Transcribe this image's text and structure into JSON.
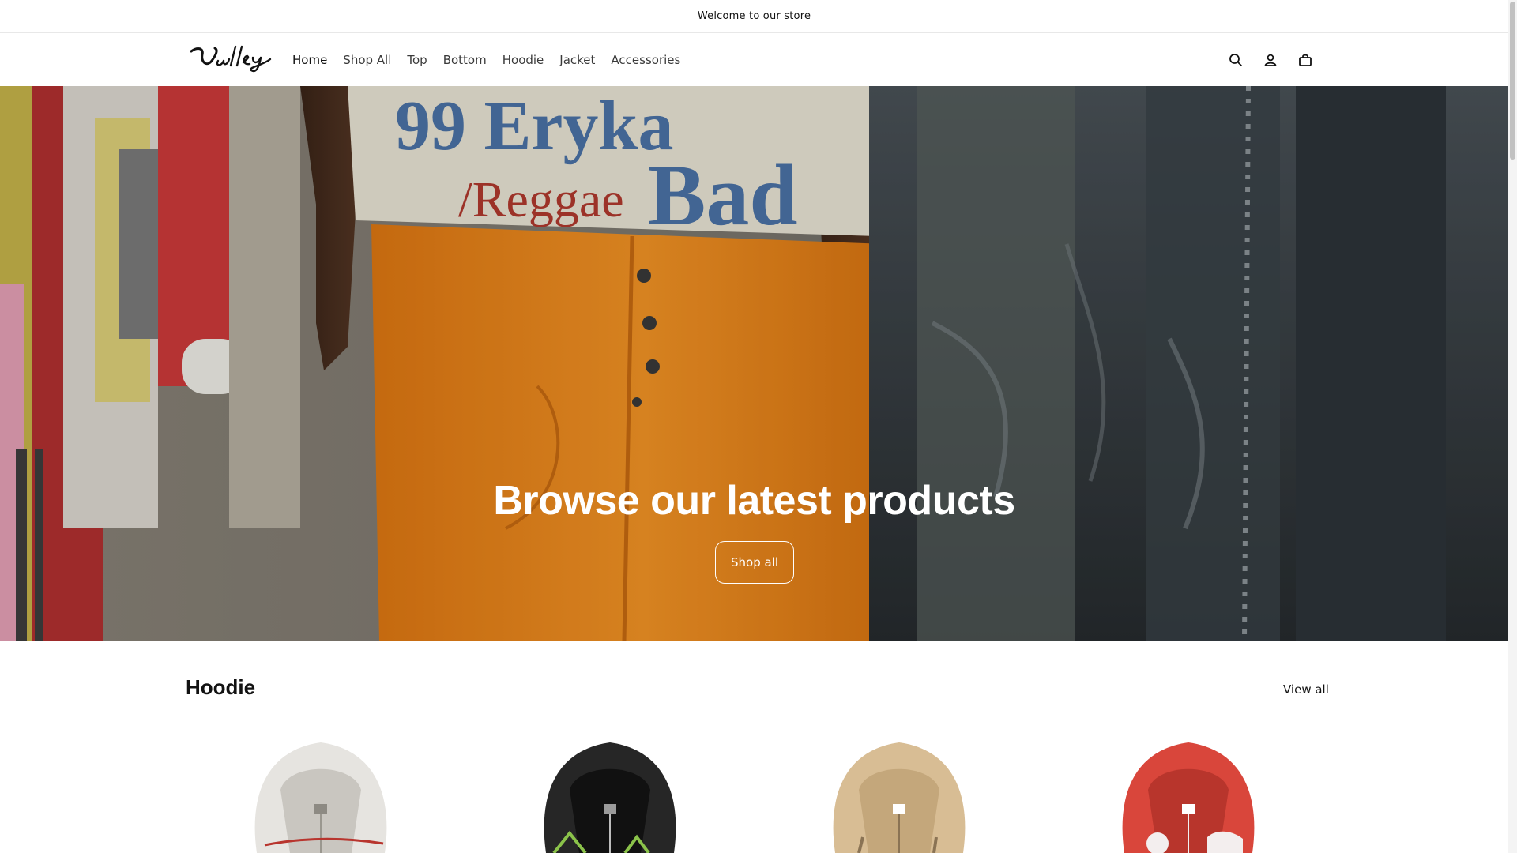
{
  "announcement": "Welcome to our store",
  "header": {
    "logo_text": "Valley",
    "nav": [
      "Home",
      "Shop All",
      "Top",
      "Bottom",
      "Hoodie",
      "Jacket",
      "Accessories"
    ],
    "icons": [
      "search-icon",
      "account-icon",
      "cart-icon"
    ]
  },
  "hero": {
    "title": "Browse our latest products",
    "button_label": "Shop all"
  },
  "section": {
    "title": "Hoodie",
    "view_all": "View all",
    "products": [
      {
        "color": "#e6e4e0"
      },
      {
        "color": "#262626"
      },
      {
        "color": "#d8bd94"
      },
      {
        "color": "#d9463b"
      }
    ]
  },
  "colors": {
    "text": "#121212",
    "hero_orange": "#f28c1e",
    "border": "#e8e8e8"
  }
}
